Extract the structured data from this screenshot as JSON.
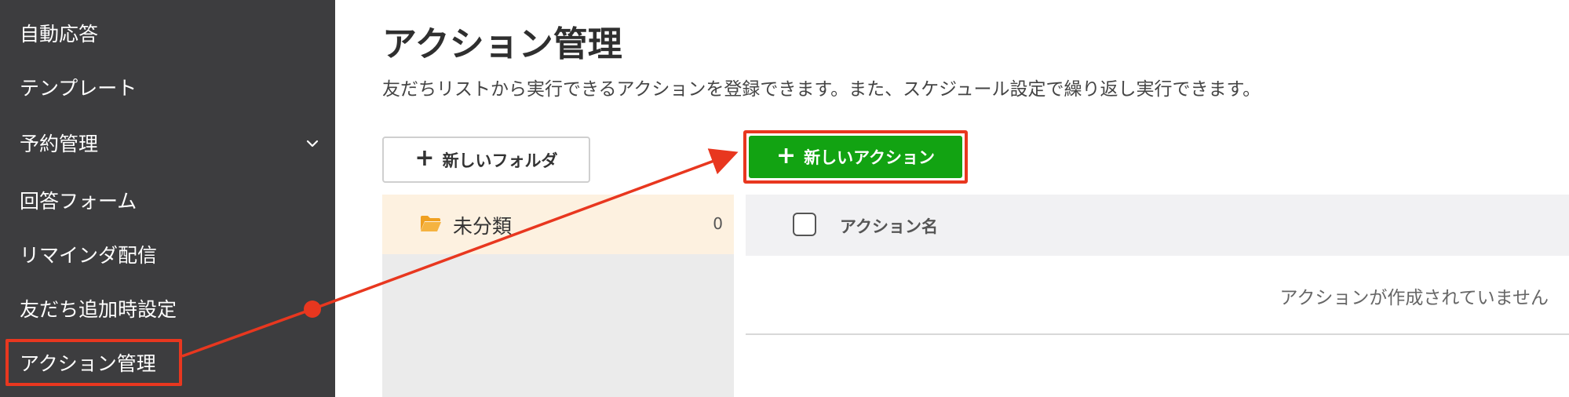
{
  "sidebar": {
    "items": [
      {
        "label": "自動応答"
      },
      {
        "label": "テンプレート"
      },
      {
        "label": "予約管理"
      },
      {
        "label": "回答フォーム"
      },
      {
        "label": "リマインダ配信"
      },
      {
        "label": "友だち追加時設定"
      },
      {
        "label": "アクション管理"
      }
    ],
    "expand_icon": "chevron-down-icon",
    "selected_label": "アクション管理"
  },
  "main": {
    "title": "アクション管理",
    "description": "友だちリストから実行できるアクションを登録できます。また、スケジュール設定で繰り返し実行できます。",
    "buttons": {
      "new_folder": "新しいフォルダ",
      "new_action": "新しいアクション",
      "plus_icon": "+"
    },
    "folders": [
      {
        "name": "未分類",
        "count": "0",
        "icon": "folder-open-icon"
      }
    ],
    "table": {
      "column_name": "アクション名",
      "empty_message": "アクションが作成されていません"
    }
  },
  "colors": {
    "sidebar_bg": "#3d3d3f",
    "accent_green": "#12a312",
    "annotation_red": "#e8371f",
    "folder_selected_bg": "#fdf1e0",
    "folder_icon": "#f0a020"
  }
}
